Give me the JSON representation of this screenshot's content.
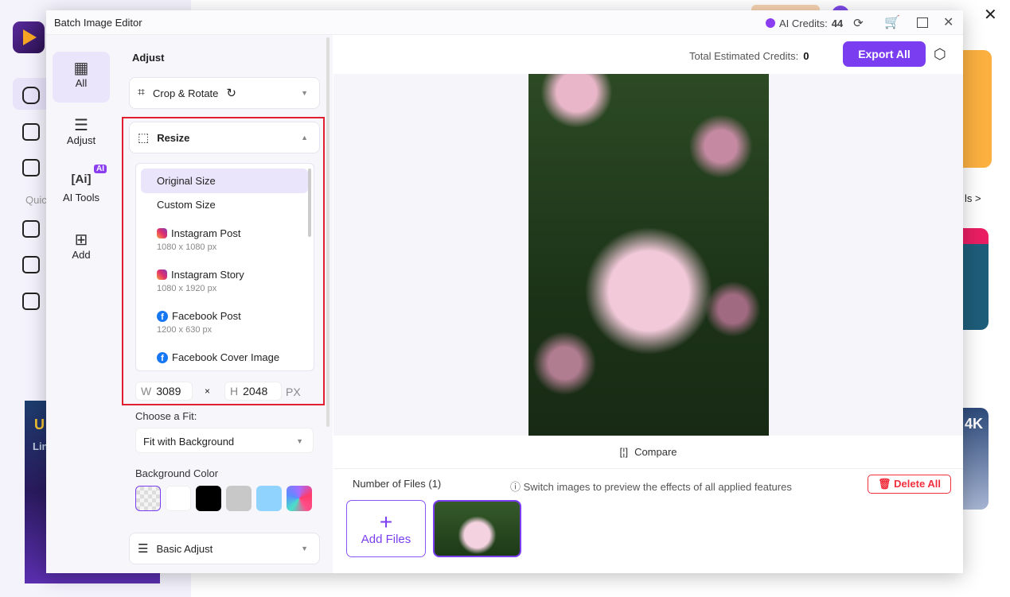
{
  "window": {
    "title": "Batch Image Editor",
    "ai_credits_label": "AI Credits:",
    "ai_credits_value": "44"
  },
  "background_app": {
    "quick_label": "Quic",
    "tools_link": "ls >",
    "banner_text": "U",
    "banner_sub": "Lin",
    "card_text": "4K"
  },
  "nav": {
    "items": [
      {
        "label": "All",
        "icon": "grid-icon"
      },
      {
        "label": "Adjust",
        "icon": "sliders-icon"
      },
      {
        "label": "AI Tools",
        "icon": "ai-icon",
        "badge": "AI"
      },
      {
        "label": "Add",
        "icon": "plus-square-icon"
      }
    ],
    "active": "All"
  },
  "panel": {
    "heading": "Adjust",
    "crop_rotate": "Crop & Rotate",
    "resize": "Resize",
    "resize_options": [
      {
        "name": "Original Size",
        "selected": true
      },
      {
        "name": "Custom Size"
      },
      {
        "name": "Instagram Post",
        "size": "1080 x 1080 px",
        "icon": "instagram-icon"
      },
      {
        "name": "Instagram Story",
        "size": "1080 x 1920 px",
        "icon": "instagram-icon"
      },
      {
        "name": "Facebook Post",
        "size": "1200 x 630 px",
        "icon": "facebook-icon"
      },
      {
        "name": "Facebook Cover Image",
        "icon": "facebook-icon"
      }
    ],
    "width_label": "W",
    "width": "3089",
    "times": "×",
    "height_label": "H",
    "height": "2048",
    "unit": "PX",
    "fit_label": "Choose a Fit:",
    "fit_value": "Fit with Background",
    "bg_color_label": "Background Color",
    "bg_colors": [
      "transparent",
      "#ffffff",
      "#000000",
      "#c8c8c8",
      "#8fd3fe",
      "gradient"
    ],
    "basic_adjust": "Basic Adjust"
  },
  "toolbar": {
    "total_label": "Total Estimated Credits:",
    "total_value": "0",
    "export": "Export All"
  },
  "preview": {
    "compare": "Compare"
  },
  "files": {
    "count_label": "Number of Files (1)",
    "hint": "Switch images to preview the effects of all applied features",
    "delete_all": "Delete All",
    "add_files": "Add Files"
  },
  "colors": {
    "accent": "#7a3df0",
    "danger": "#f0303f",
    "highlight": "#e02030"
  }
}
